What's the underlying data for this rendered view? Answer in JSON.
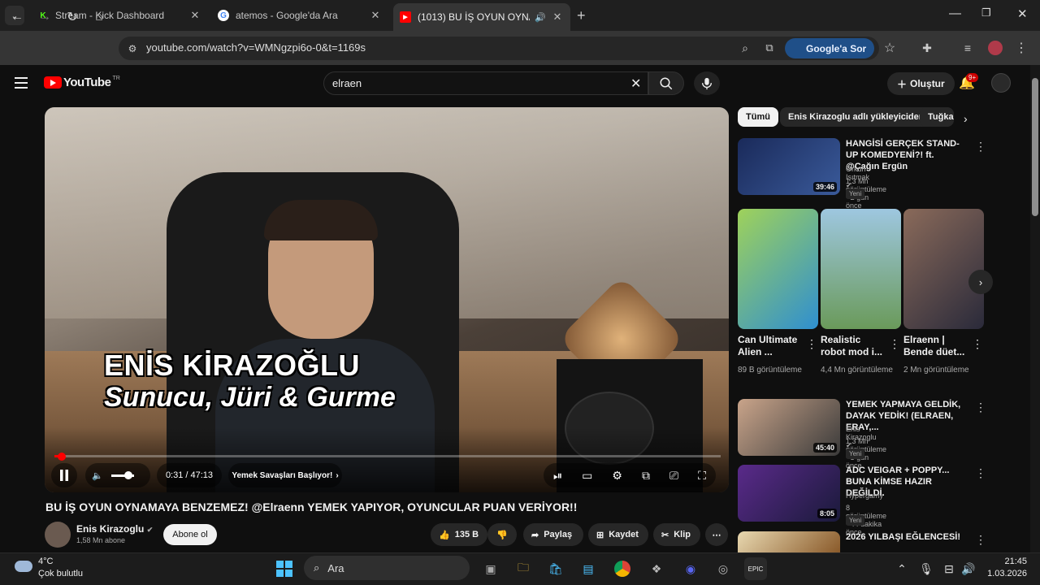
{
  "browser": {
    "tabs": [
      {
        "title": "Stream - Kick Dashboard",
        "fav": "K",
        "fav_color": "#53fc18"
      },
      {
        "title": "atemos - Google'da Ara",
        "fav": "G",
        "fav_color": "#ffffff"
      },
      {
        "title": "(1013) BU İŞ OYUN OYNAM",
        "fav": "▶",
        "fav_color": "#ff0000"
      }
    ],
    "url": "youtube.com/watch?v=WMNgzpi6o-0&t=1169s",
    "ask_google": "Google'a Sor"
  },
  "youtube": {
    "logo_text": "YouTube",
    "region": "TR",
    "search_value": "elraen",
    "create_label": "Oluştur",
    "notif_count": "9+"
  },
  "video": {
    "caption_name": "ENİS KİRAZOĞLU",
    "caption_role": "Sunucu, Jüri & Gurme",
    "time": "0:31 / 47:13",
    "chapter": "Yemek Savaşları Başlıyor!",
    "progress_fraction": 0.011,
    "title": "BU İŞ OYUN OYNAMAYA BENZEMEZ! @Elraenn YEMEK YAPIYOR, OYUNCULAR PUAN VERİYOR!!",
    "channel": "Enis Kirazoglu",
    "subs": "1,58 Mn abone",
    "subscribe": "Abone ol",
    "likes": "135 B",
    "share": "Paylaş",
    "save": "Kaydet",
    "clip": "Klip"
  },
  "sidebar": {
    "chips": [
      "Tümü",
      "Enis Kirazoglu adlı yükleyiciden",
      "Tuğka"
    ],
    "videos": [
      {
        "title": "HANGİSİ GERÇEK STAND-UP KOMEDYENİ?! ft. @Çağın Ergün",
        "channel": "Orkun Işıtmak",
        "meta": "1,3 Mn görüntüleme • 2 gün önce",
        "badge": "Yeni",
        "duration": "39:46"
      },
      {
        "title": "YEMEK YAPMAYA GELDİK, DAYAK YEDİK! (ELRAEN, ERAY,...",
        "channel": "Enis Kirazoglu",
        "meta": "1,3 Mn görüntüleme • 3 gün önce",
        "badge": "Yeni",
        "duration": "45:40"
      },
      {
        "title": "ADC VEIGAR + POPPY... BUNA KİMSE HAZIR DEĞİLDİ.",
        "channel": "Hypergamy",
        "meta": "8 görüntüleme • 44 dakika önce",
        "badge": "Yeni",
        "duration": "8:05"
      },
      {
        "title": "2026 YILBAŞI EĞLENCESİ!",
        "channel": "",
        "meta": "",
        "badge": "",
        "duration": ""
      }
    ],
    "shorts": [
      {
        "title": "Can Ultimate Alien ...",
        "views": "89 B görüntüleme"
      },
      {
        "title": "Realistic robot mod i...",
        "views": "4,4 Mn görüntüleme"
      },
      {
        "title": "Elraenn | Bende düet...",
        "views": "2 Mn görüntüleme"
      }
    ]
  },
  "taskbar": {
    "temp": "4°C",
    "weather": "Çok bulutlu",
    "search_placeholder": "Ara",
    "time": "21:45",
    "date": "1.03.2026"
  }
}
